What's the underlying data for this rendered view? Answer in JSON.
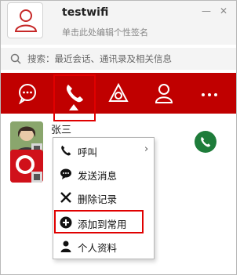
{
  "header": {
    "username": "testwifi",
    "signature": "单击此处编辑个性签名",
    "minimize_label": "—",
    "close_label": "✕"
  },
  "search": {
    "text": "搜索：最近会话、通讯录及相关信息"
  },
  "tabs": [
    {
      "icon": "chat-bubble-icon"
    },
    {
      "icon": "phone-icon",
      "selected": true
    },
    {
      "icon": "discover-icon"
    },
    {
      "icon": "contacts-person-icon"
    },
    {
      "icon": "more-dots-icon"
    }
  ],
  "contacts": [
    {
      "name": "张三"
    }
  ],
  "context_menu": {
    "items": [
      {
        "label": "呼叫",
        "icon": "phone-icon",
        "has_submenu": true
      },
      {
        "label": "发送消息",
        "icon": "message-icon"
      },
      {
        "label": "删除记录",
        "icon": "delete-x-icon"
      },
      {
        "label": "添加到常用",
        "icon": "plus-circle-icon",
        "highlighted": true
      },
      {
        "label": "个人资料",
        "icon": "profile-icon"
      }
    ]
  },
  "colors": {
    "accent": "#c00000",
    "call_green": "#1e7c3a",
    "highlight_border": "#e00000"
  }
}
